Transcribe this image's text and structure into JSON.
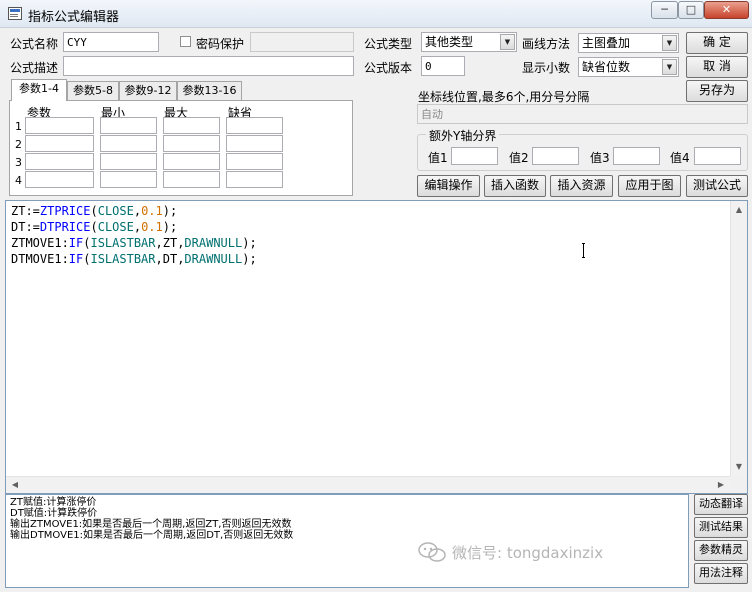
{
  "window": {
    "title": "指标公式编辑器",
    "controls": {
      "minimize": "─",
      "maximize": "□",
      "close": "✕"
    }
  },
  "form": {
    "name_label": "公式名称",
    "name_value": "CYY",
    "password_label": "密码保护",
    "password_checked": false,
    "type_label": "公式类型",
    "type_value": "其他类型",
    "draw_method_label": "画线方法",
    "draw_method_value": "主图叠加",
    "desc_label": "公式描述",
    "desc_value": "",
    "version_label": "公式版本",
    "version_value": "0",
    "decimals_label": "显示小数",
    "decimals_value": "缺省位数"
  },
  "buttons": {
    "ok": "确  定",
    "cancel": "取  消",
    "save_as": "另存为",
    "edit_ops": "编辑操作",
    "insert_func": "插入函数",
    "insert_res": "插入资源",
    "apply_chart": "应用于图",
    "test_formula": "测试公式",
    "dyn_translate": "动态翻译",
    "test_result": "测试结果",
    "param_wizard": "参数精灵",
    "usage_notes": "用法注释"
  },
  "param_tabs": [
    "参数1-4",
    "参数5-8",
    "参数9-12",
    "参数13-16"
  ],
  "param_headers": [
    "参数",
    "最小",
    "最大",
    "缺省"
  ],
  "param_rows": [
    "1",
    "2",
    "3",
    "4"
  ],
  "coord": {
    "label": "坐标线位置,最多6个,用分号分隔",
    "value": "自动"
  },
  "yaxis": {
    "group_label": "额外Y轴分界",
    "labels": [
      "值1",
      "值2",
      "值3",
      "值4"
    ]
  },
  "code_lines": [
    [
      {
        "t": "ZT:=",
        "c": "pl"
      },
      {
        "t": "ZTPRICE",
        "c": "kw"
      },
      {
        "t": "(",
        "c": "pl"
      },
      {
        "t": "CLOSE",
        "c": "fn"
      },
      {
        "t": ",",
        "c": "pl"
      },
      {
        "t": "0.1",
        "c": "num"
      },
      {
        "t": ");",
        "c": "pl"
      }
    ],
    [
      {
        "t": "DT:=",
        "c": "pl"
      },
      {
        "t": "DTPRICE",
        "c": "kw"
      },
      {
        "t": "(",
        "c": "pl"
      },
      {
        "t": "CLOSE",
        "c": "fn"
      },
      {
        "t": ",",
        "c": "pl"
      },
      {
        "t": "0.1",
        "c": "num"
      },
      {
        "t": ");",
        "c": "pl"
      }
    ],
    [
      {
        "t": "ZTMOVE1:",
        "c": "pl"
      },
      {
        "t": "IF",
        "c": "kw"
      },
      {
        "t": "(",
        "c": "pl"
      },
      {
        "t": "ISLASTBAR",
        "c": "fn"
      },
      {
        "t": ",ZT,",
        "c": "pl"
      },
      {
        "t": "DRAWNULL",
        "c": "fn"
      },
      {
        "t": ");",
        "c": "pl"
      }
    ],
    [
      {
        "t": "DTMOVE1:",
        "c": "pl"
      },
      {
        "t": "IF",
        "c": "kw"
      },
      {
        "t": "(",
        "c": "pl"
      },
      {
        "t": "ISLASTBAR",
        "c": "fn"
      },
      {
        "t": ",DT,",
        "c": "pl"
      },
      {
        "t": "DRAWNULL",
        "c": "fn"
      },
      {
        "t": ");",
        "c": "pl"
      }
    ]
  ],
  "output_lines": [
    "ZT赋值:计算涨停价",
    "DT赋值:计算跌停价",
    "输出ZTMOVE1:如果是否最后一个周期,返回ZT,否则返回无效数",
    "输出DTMOVE1:如果是否最后一个周期,返回DT,否则返回无效数"
  ],
  "watermark": "微信号: tongdaxinzix",
  "colors": {
    "keyword": "#0000ff",
    "function": "#007070",
    "number": "#d07000"
  }
}
